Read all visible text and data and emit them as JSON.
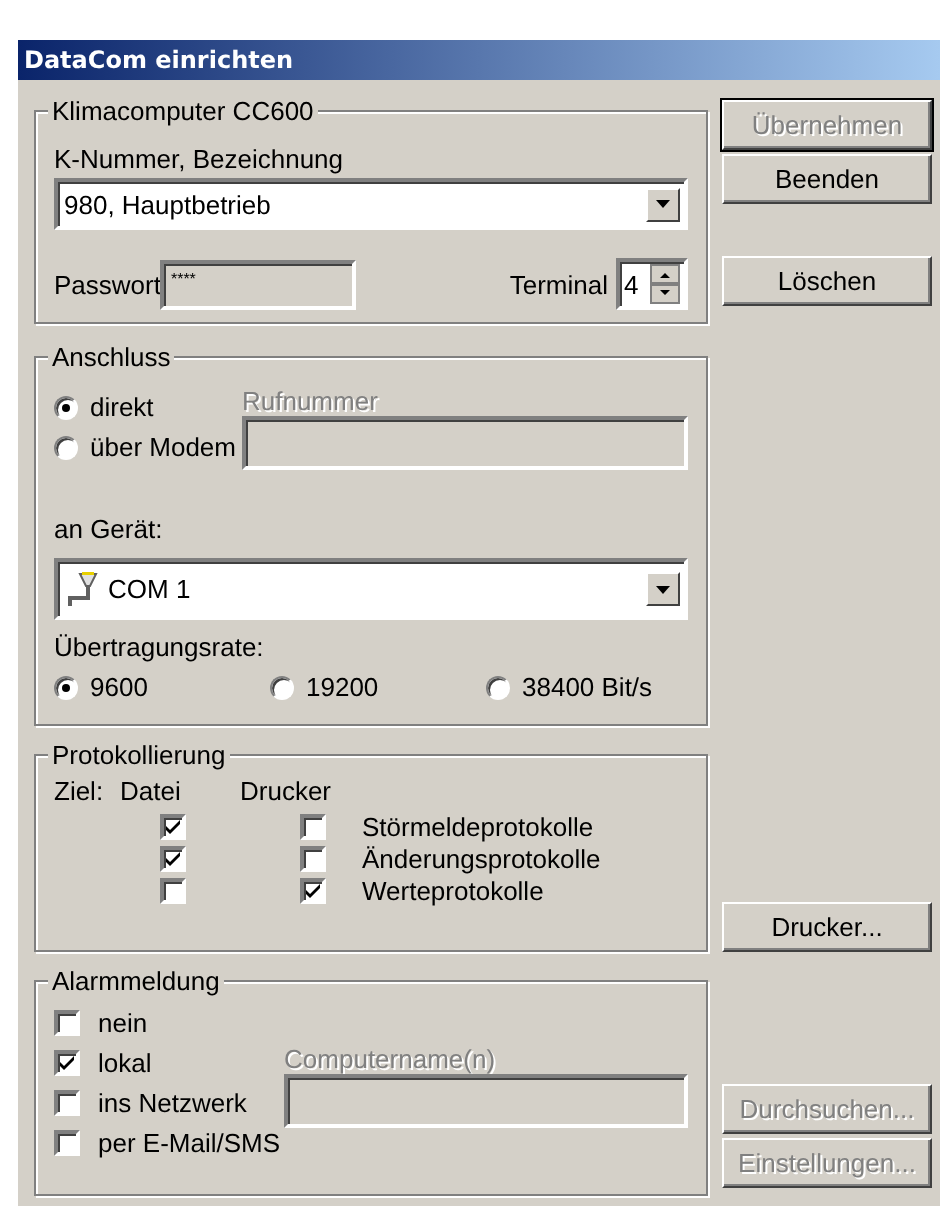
{
  "window": {
    "title": "DataCom einrichten"
  },
  "klimacomputer": {
    "legend": "Klimacomputer CC600",
    "select_label": "K-Nummer, Bezeichnung",
    "select_value": "980, Hauptbetrieb",
    "password_label": "Passwort",
    "password_value": "****",
    "terminal_label": "Terminal",
    "terminal_value": "4",
    "buttons": [
      {
        "label": "Übernehmen",
        "disabled": true
      },
      {
        "label": "Beenden",
        "disabled": false
      },
      {
        "label": "Löschen",
        "disabled": false
      }
    ]
  },
  "anschluss": {
    "legend": "Anschluss",
    "modes": [
      {
        "label": "direkt",
        "selected": true
      },
      {
        "label": "über Modem",
        "selected": false
      }
    ],
    "phone_label": "Rufnummer",
    "phone_disabled": true,
    "device_label": "an Gerät:",
    "device_value": "COM 1",
    "rate_label": "Übertragungsrate:",
    "rates": [
      {
        "label": "9600",
        "selected": true
      },
      {
        "label": "19200",
        "selected": false
      },
      {
        "label": "38400 Bit/s",
        "selected": false
      }
    ]
  },
  "protokollierung": {
    "legend": "Protokollierung",
    "target_label": "Ziel:",
    "file_header": "Datei",
    "printer_header": "Drucker",
    "rows": [
      {
        "label": "Störmeldeprotokolle",
        "file": true,
        "printer": false
      },
      {
        "label": "Änderungsprotokolle",
        "file": true,
        "printer": false
      },
      {
        "label": "Werteprotokolle",
        "file": false,
        "printer": true
      }
    ],
    "buttons": [
      {
        "label": "Drucker...",
        "disabled": false
      }
    ]
  },
  "alarmmeldung": {
    "legend": "Alarmmeldung",
    "options": [
      {
        "label": "nein",
        "checked": false
      },
      {
        "label": "lokal",
        "checked": true
      },
      {
        "label": "ins Netzwerk",
        "checked": false
      },
      {
        "label": "per E-Mail/SMS",
        "checked": false
      }
    ],
    "computer_label": "Computername(n)",
    "computer_disabled": true,
    "buttons": [
      {
        "label": "Durchsuchen...",
        "disabled": true
      },
      {
        "label": "Einstellungen...",
        "disabled": true
      }
    ]
  }
}
